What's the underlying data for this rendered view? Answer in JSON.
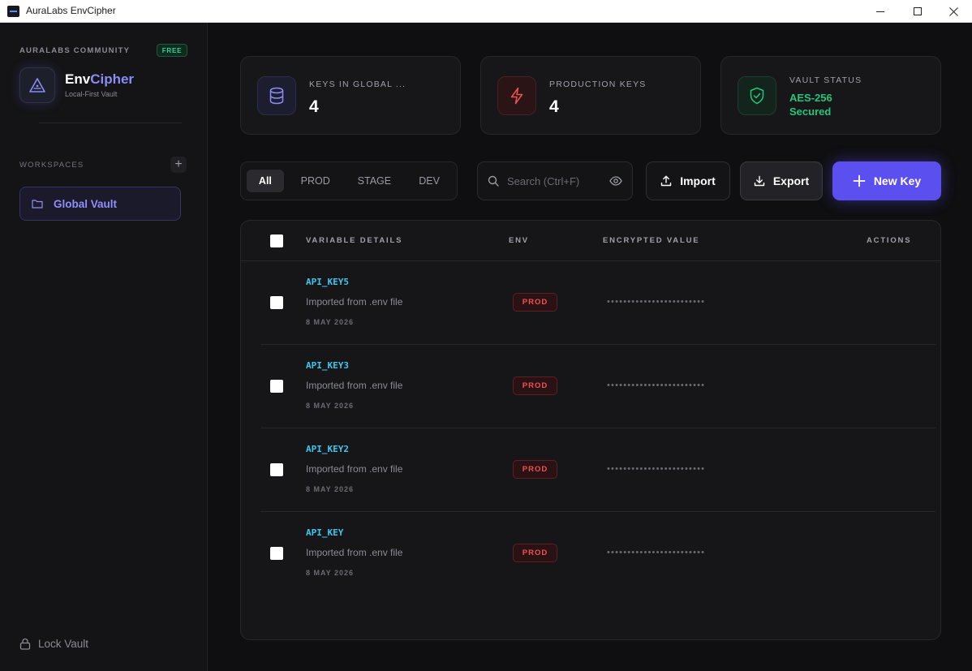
{
  "window": {
    "title": "AuraLabs EnvCipher"
  },
  "sidebar": {
    "community_label": "AURALABS COMMUNITY",
    "plan_badge": "FREE",
    "brand_primary": "Env",
    "brand_accent": "Cipher",
    "brand_subtitle": "Local-First Vault",
    "workspaces_label": "WORKSPACES",
    "add_workspace_symbol": "+",
    "workspaces": [
      {
        "name": "Global Vault",
        "icon": "folder-icon",
        "active": true
      }
    ],
    "lock_label": "Lock Vault"
  },
  "stats": [
    {
      "label": "KEYS IN GLOBAL ...",
      "value": "4",
      "icon": "database-icon"
    },
    {
      "label": "PRODUCTION KEYS",
      "value": "4",
      "icon": "bolt-icon"
    },
    {
      "label": "VAULT STATUS",
      "value_line1": "AES-256",
      "value_line2": "Secured",
      "icon": "shield-check-icon"
    }
  ],
  "filters": {
    "tabs": [
      "All",
      "PROD",
      "STAGE",
      "DEV"
    ],
    "active": "All"
  },
  "search": {
    "placeholder": "Search (Ctrl+F)",
    "value": ""
  },
  "toolbar": {
    "import_label": "Import",
    "export_label": "Export",
    "new_key_label": "New Key"
  },
  "table": {
    "headers": {
      "details": "VARIABLE DETAILS",
      "env": "ENV",
      "value": "ENCRYPTED VALUE",
      "actions": "ACTIONS"
    },
    "rows": [
      {
        "key": "API_KEY5",
        "description": "Imported from .env file",
        "date": "8 MAY 2026",
        "env": "PROD",
        "masked": "••••••••••••••••••••••••"
      },
      {
        "key": "API_KEY3",
        "description": "Imported from .env file",
        "date": "8 MAY 2026",
        "env": "PROD",
        "masked": "••••••••••••••••••••••••"
      },
      {
        "key": "API_KEY2",
        "description": "Imported from .env file",
        "date": "8 MAY 2026",
        "env": "PROD",
        "masked": "••••••••••••••••••••••••"
      },
      {
        "key": "API_KEY",
        "description": "Imported from .env file",
        "date": "8 MAY 2026",
        "env": "PROD",
        "masked": "••••••••••••••••••••••••"
      }
    ]
  },
  "colors": {
    "accent": "#5b4ff0",
    "key_text": "#3cc8f0",
    "prod": "#f05252",
    "secured": "#22c67a"
  }
}
